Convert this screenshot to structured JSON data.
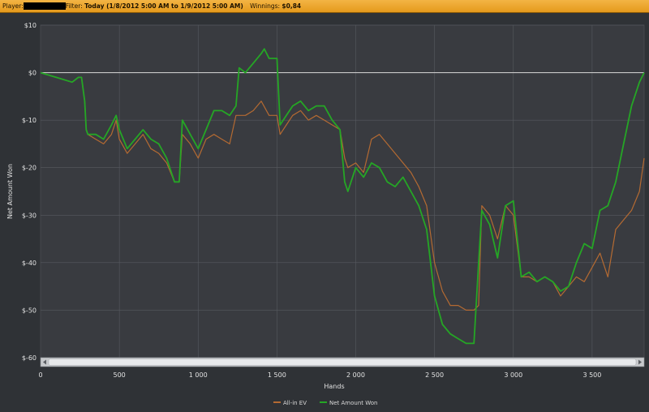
{
  "header": {
    "player_label": "Player:",
    "filter_label": "Filter:",
    "filter_value": "Today (1/8/2012 5:00 AM to 1/9/2012 5:00 AM)",
    "winnings_label": "Winnings:",
    "winnings_value": "$0,84"
  },
  "colors": {
    "background": "#2f3236",
    "plot_background": "#393b40",
    "grid": "#575a60",
    "zero_line": "#c8c8c8",
    "allin_ev": "#b46a32",
    "net_won": "#25a625",
    "header_bar": "#ec9f22"
  },
  "chart_data": {
    "type": "line",
    "xlabel": "Hands",
    "ylabel": "Net Amount Won",
    "xlim": [
      0,
      3830
    ],
    "ylim": [
      -60,
      10
    ],
    "x_ticks": [
      0,
      500,
      1000,
      1500,
      2000,
      2500,
      3000,
      3500
    ],
    "x_tick_labels": [
      "0",
      "500",
      "1 000",
      "1 500",
      "2 000",
      "2 500",
      "3 000",
      "3 500"
    ],
    "y_ticks": [
      10,
      0,
      -10,
      -20,
      -30,
      -40,
      -50,
      -60
    ],
    "y_tick_labels": [
      "$10",
      "$0",
      "$-10",
      "$-20",
      "$-30",
      "$-40",
      "$-50",
      "$-60"
    ],
    "grid": true,
    "legend_position": "bottom-center",
    "series": [
      {
        "name": "All-in EV",
        "color": "#b46a32",
        "x": [
          0,
          100,
          200,
          240,
          260,
          280,
          290,
          300,
          350,
          400,
          450,
          480,
          500,
          550,
          600,
          650,
          700,
          750,
          800,
          850,
          880,
          900,
          950,
          1000,
          1050,
          1100,
          1150,
          1200,
          1240,
          1300,
          1350,
          1400,
          1450,
          1500,
          1520,
          1560,
          1600,
          1650,
          1700,
          1750,
          1800,
          1850,
          1900,
          1930,
          1950,
          2000,
          2050,
          2100,
          2150,
          2200,
          2250,
          2300,
          2350,
          2400,
          2450,
          2500,
          2550,
          2600,
          2650,
          2700,
          2750,
          2780,
          2800,
          2850,
          2900,
          2950,
          3000,
          3050,
          3100,
          3150,
          3200,
          3250,
          3300,
          3350,
          3400,
          3450,
          3500,
          3550,
          3600,
          3650,
          3700,
          3750,
          3800,
          3830
        ],
        "y": [
          0,
          -1,
          -2,
          -1,
          -1,
          -6,
          -12,
          -13,
          -14,
          -15,
          -13,
          -10,
          -14,
          -17,
          -15,
          -13,
          -16,
          -17,
          -19,
          -23,
          -23,
          -13,
          -15,
          -18,
          -14,
          -13,
          -14,
          -15,
          -9,
          -9,
          -8,
          -6,
          -9,
          -9,
          -13,
          -11,
          -9,
          -8,
          -10,
          -9,
          -10,
          -11,
          -12,
          -18,
          -20,
          -19,
          -21,
          -14,
          -13,
          -15,
          -17,
          -19,
          -21,
          -24,
          -28,
          -40,
          -46,
          -49,
          -49,
          -50,
          -50,
          -49,
          -28,
          -30,
          -35,
          -28,
          -30,
          -43,
          -43,
          -44,
          -43,
          -44,
          -47,
          -45,
          -43,
          -44,
          -41,
          -38,
          -43,
          -33,
          -31,
          -29,
          -25,
          -18
        ]
      },
      {
        "name": "Net Amount Won",
        "color": "#25a625",
        "x": [
          0,
          100,
          200,
          240,
          260,
          280,
          290,
          300,
          350,
          400,
          450,
          480,
          500,
          550,
          600,
          650,
          700,
          750,
          800,
          850,
          880,
          900,
          950,
          1000,
          1050,
          1100,
          1150,
          1200,
          1240,
          1260,
          1300,
          1350,
          1400,
          1420,
          1450,
          1500,
          1520,
          1560,
          1600,
          1650,
          1700,
          1750,
          1800,
          1850,
          1900,
          1930,
          1950,
          2000,
          2050,
          2100,
          2150,
          2200,
          2250,
          2300,
          2350,
          2400,
          2450,
          2500,
          2550,
          2600,
          2650,
          2700,
          2750,
          2780,
          2800,
          2850,
          2900,
          2950,
          3000,
          3050,
          3100,
          3150,
          3200,
          3250,
          3300,
          3350,
          3400,
          3450,
          3500,
          3550,
          3600,
          3650,
          3700,
          3750,
          3800,
          3830
        ],
        "y": [
          0,
          -1,
          -2,
          -1,
          -1,
          -6,
          -12,
          -13,
          -13,
          -14,
          -11,
          -9,
          -12,
          -16,
          -14,
          -12,
          -14,
          -15,
          -18,
          -23,
          -23,
          -10,
          -13,
          -16,
          -12,
          -8,
          -8,
          -9,
          -7,
          1,
          0,
          2,
          4,
          5,
          3,
          3,
          -11,
          -9,
          -7,
          -6,
          -8,
          -7,
          -7,
          -10,
          -12,
          -23,
          -25,
          -20,
          -22,
          -19,
          -20,
          -23,
          -24,
          -22,
          -25,
          -28,
          -33,
          -47,
          -53,
          -55,
          -56,
          -57,
          -57,
          -40,
          -29,
          -32,
          -39,
          -28,
          -27,
          -43,
          -42,
          -44,
          -43,
          -44,
          -46,
          -45,
          -40,
          -36,
          -37,
          -29,
          -28,
          -23,
          -15,
          -7,
          -2,
          0
        ]
      }
    ]
  }
}
